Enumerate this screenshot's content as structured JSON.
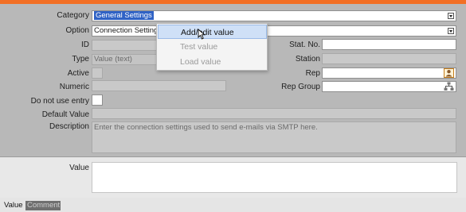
{
  "form": {
    "category": {
      "label": "Category",
      "value": "General Settings"
    },
    "option": {
      "label": "Option",
      "value": "Connection Setting"
    },
    "id": {
      "label": "ID",
      "value": ""
    },
    "type": {
      "label": "Type",
      "value": "Value (text)"
    },
    "active": {
      "label": "Active"
    },
    "numeric": {
      "label": "Numeric",
      "value": ""
    },
    "do_not_use_entry": {
      "label": "Do not use entry"
    },
    "default_value": {
      "label": "Default Value",
      "value": ""
    },
    "description": {
      "label": "Description",
      "value": "Enter the connection settings used to send e-mails via SMTP here."
    },
    "stat_no": {
      "label": "Stat. No.",
      "value": ""
    },
    "station": {
      "label": "Station",
      "value": ""
    },
    "rep": {
      "label": "Rep",
      "value": ""
    },
    "rep_group": {
      "label": "Rep Group",
      "value": ""
    }
  },
  "context_menu": {
    "items": [
      {
        "label": "Add/edit value",
        "enabled": true,
        "highlighted": true
      },
      {
        "label": "Test value",
        "enabled": false
      },
      {
        "label": "Load value",
        "enabled": false
      }
    ]
  },
  "value_panel": {
    "label": "Value",
    "value": ""
  },
  "tabs": [
    {
      "label": "Value",
      "active": true
    },
    {
      "label": "Comment",
      "active": false
    }
  ],
  "colors": {
    "accent": "#f26f25",
    "selection": "#2f62c5",
    "menu_highlight": "#cfe0f7"
  }
}
